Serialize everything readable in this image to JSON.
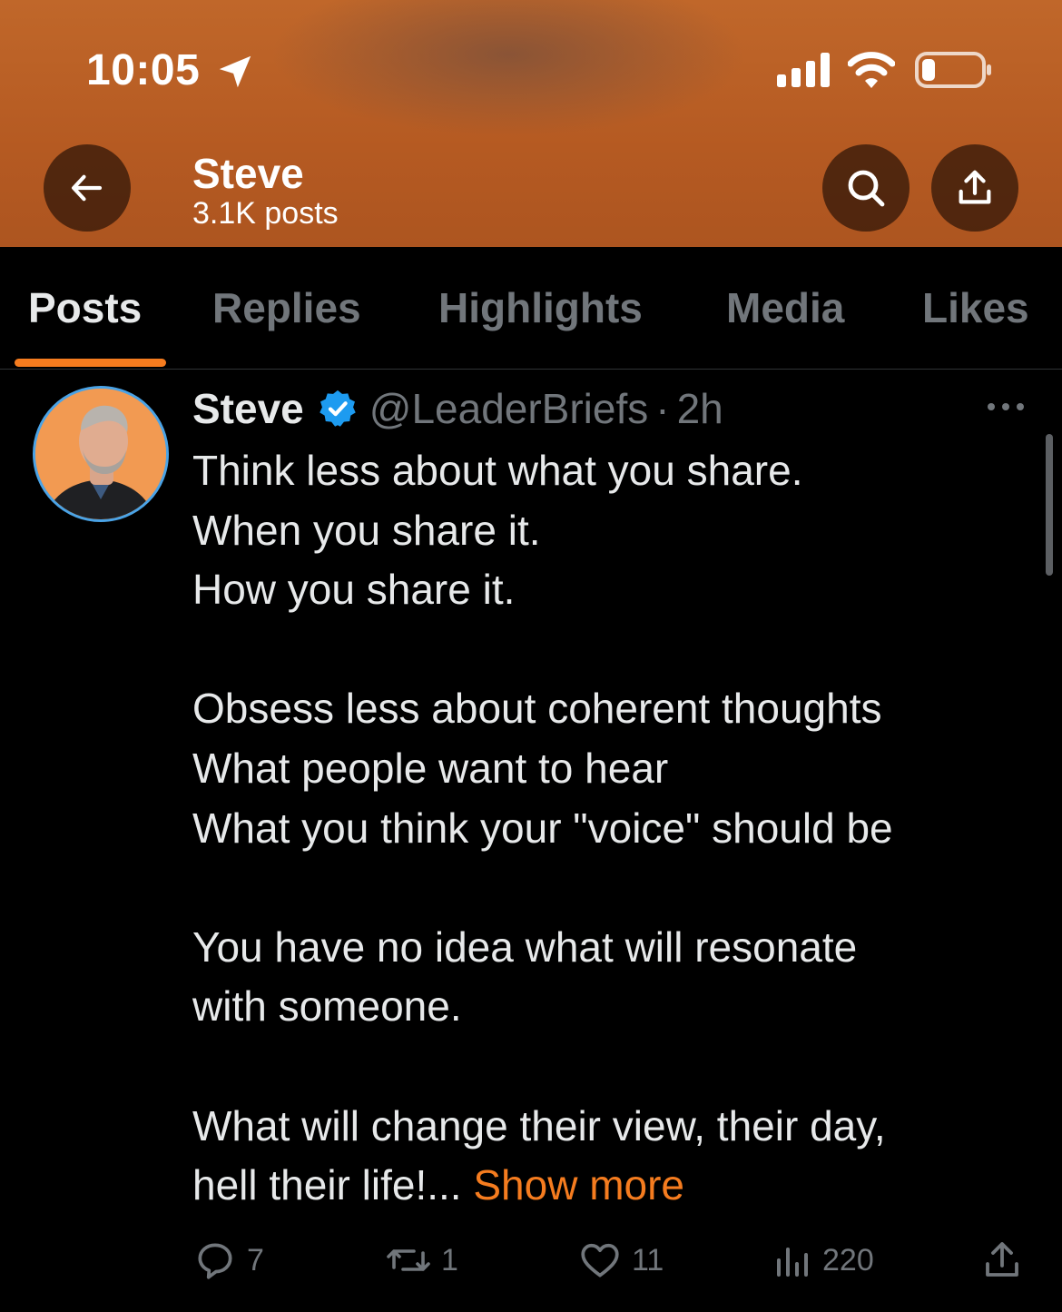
{
  "status_bar": {
    "time": "10:05"
  },
  "profile_header": {
    "name": "Steve",
    "post_count": "3.1K posts"
  },
  "tabs": [
    {
      "label": "Posts",
      "active": true
    },
    {
      "label": "Replies",
      "active": false
    },
    {
      "label": "Highlights",
      "active": false
    },
    {
      "label": "Media",
      "active": false
    },
    {
      "label": "Likes",
      "active": false
    }
  ],
  "post": {
    "author_name": "Steve",
    "handle": "@LeaderBriefs",
    "separator": "·",
    "time": "2h",
    "lines": [
      "Think less about what you share.",
      "When you share it.",
      "How you share it.",
      "",
      "Obsess less about coherent thoughts",
      "What people want to hear",
      "What you think your \"voice\" should be",
      "",
      "You have no idea what will resonate",
      "with someone.",
      "",
      "What will change their view, their day,"
    ],
    "last_line": "hell their life!... ",
    "show_more": "Show more",
    "stats": {
      "replies": "7",
      "reposts": "1",
      "likes": "11",
      "views": "220"
    }
  },
  "colors": {
    "accent": "#f57c1f",
    "verified": "#1d9bf0",
    "muted": "#71767b",
    "text": "#e7e9ea",
    "background": "#000000"
  }
}
